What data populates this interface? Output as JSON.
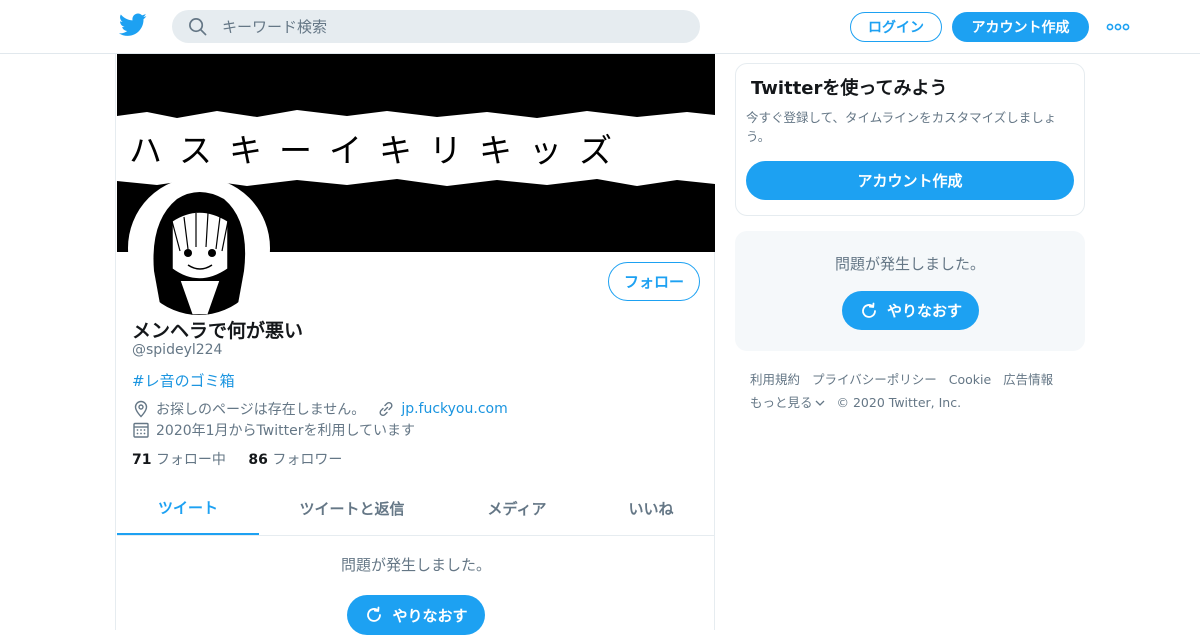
{
  "topbar": {
    "search_placeholder": "キーワード検索",
    "login_label": "ログイン",
    "signup_label": "アカウント作成"
  },
  "profile": {
    "banner_text": "ハスキーイキリキッズ",
    "follow_label": "フォロー",
    "display_name": "メンヘラで何が悪い",
    "handle": "@spideyl224",
    "bio": "#レ音のゴミ箱",
    "location": "お探しのページは存在しません。",
    "website": "jp.fuckyou.com",
    "joined": "2020年1月からTwitterを利用しています",
    "following_count": "71",
    "following_label": "フォロー中",
    "followers_count": "86",
    "followers_label": "フォロワー"
  },
  "tabs": [
    {
      "label": "ツイート",
      "active": true
    },
    {
      "label": "ツイートと返信",
      "active": false
    },
    {
      "label": "メディア",
      "active": false
    },
    {
      "label": "いいね",
      "active": false
    }
  ],
  "timeline": {
    "error_text": "問題が発生しました。",
    "retry_label": "やりなおす"
  },
  "sidebar": {
    "signup_card": {
      "title": "Twitterを使ってみよう",
      "description": "今すぐ登録して、タイムラインをカスタマイズしましょう。",
      "button_label": "アカウント作成"
    },
    "error_card": {
      "error_text": "問題が発生しました。",
      "retry_label": "やりなおす"
    },
    "footer_links": [
      "利用規約",
      "プライバシーポリシー",
      "Cookie",
      "広告情報"
    ],
    "more_label": "もっと見る",
    "copyright": "© 2020 Twitter, Inc."
  },
  "colors": {
    "accent": "#1da1f2",
    "link": "#1b95e0",
    "secondary_text": "#657786",
    "border": "#e6ecf0"
  },
  "icons": [
    "twitter-bird-icon",
    "search-icon",
    "more-dots-icon",
    "location-pin-icon",
    "link-icon",
    "calendar-icon",
    "refresh-icon",
    "chevron-down-icon"
  ]
}
